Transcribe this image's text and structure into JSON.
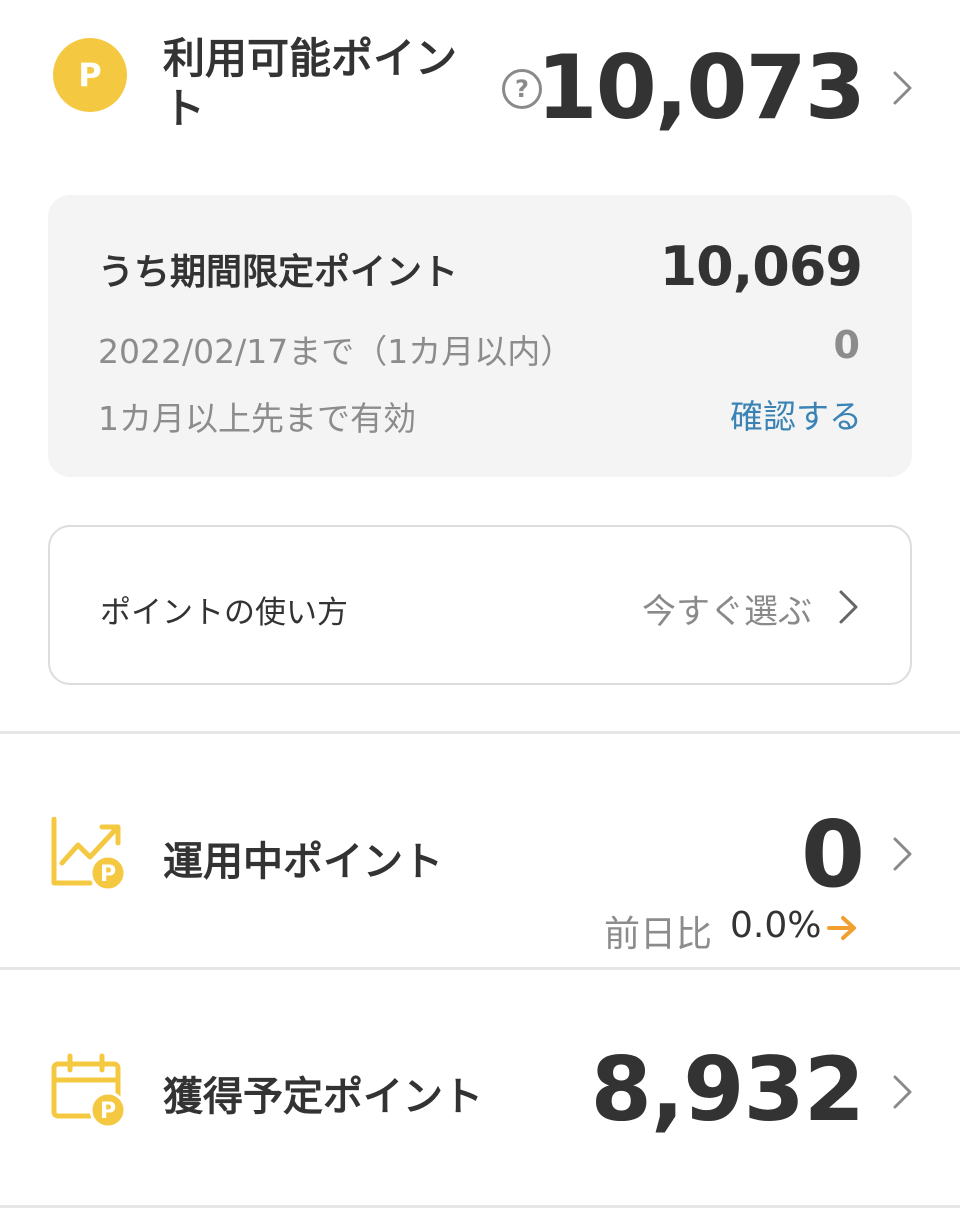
{
  "available": {
    "coin_letter": "P",
    "label": "利用可能ポイント",
    "help_symbol": "?",
    "value": "10,073"
  },
  "limited": {
    "title": "うち期間限定ポイント",
    "total": "10,069",
    "row1_label": "2022/02/17まで（1カ月以内）",
    "row1_value": "0",
    "row2_label": "1カ月以上先まで有効",
    "row2_link": "確認する"
  },
  "usage": {
    "label": "ポイントの使い方",
    "action": "今すぐ選ぶ"
  },
  "invest": {
    "icon": "chart-up-point-icon",
    "label": "運用中ポイント",
    "value": "0",
    "change_label": "前日比",
    "change_value": "0.0%"
  },
  "pending": {
    "icon": "calendar-point-icon",
    "label": "獲得予定ポイント",
    "value": "8,932"
  },
  "colors": {
    "coin": "#f5c842",
    "icon_yellow": "#f5c842",
    "arrow_orange": "#f0a030",
    "link_blue": "#3b83b5",
    "gray_box": "#f4f4f4"
  }
}
